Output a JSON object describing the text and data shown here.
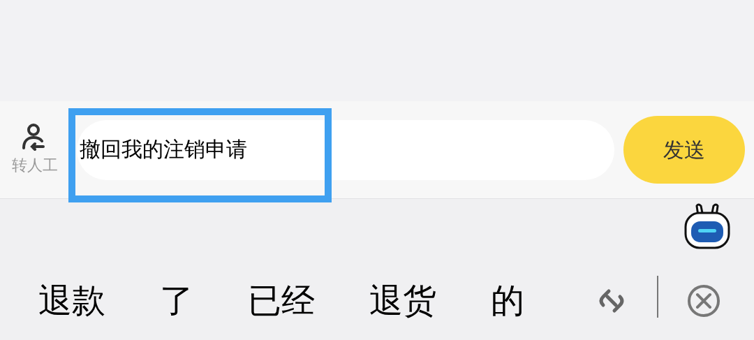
{
  "input_bar": {
    "transfer_label": "转人工",
    "input": {
      "value": "撤回我的注销申请",
      "highlighted": true
    },
    "send_button": "发送"
  },
  "suggestions": [
    "退款",
    "了",
    "已经",
    "退货",
    "的"
  ]
}
